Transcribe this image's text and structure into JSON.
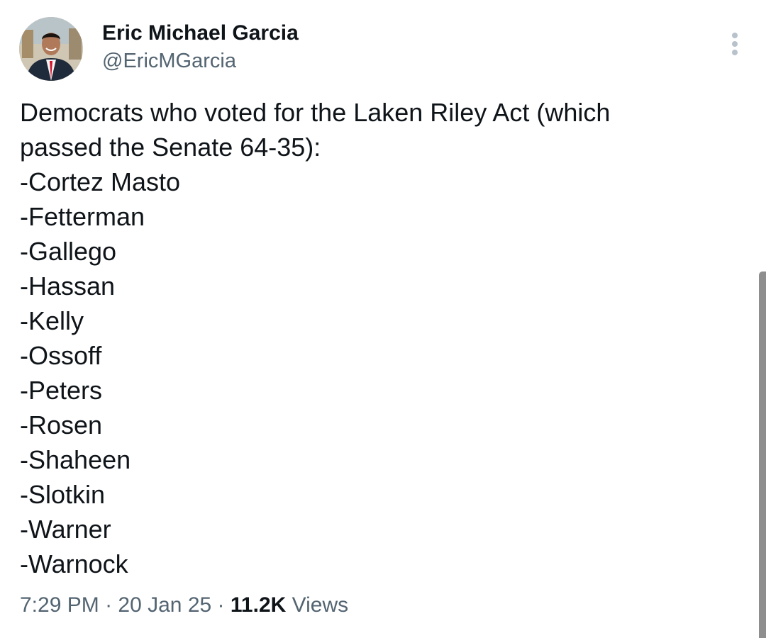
{
  "author": {
    "display_name": "Eric Michael Garcia",
    "handle": "@EricMGarcia",
    "avatar_icon": "profile-photo"
  },
  "tweet": {
    "intro_lines": [
      "Democrats who voted for the Laken Riley Act (which",
      "passed the Senate 64-35):"
    ],
    "names": [
      "-Cortez Masto",
      "-Fetterman",
      "-Gallego",
      "-Hassan",
      "-Kelly",
      "-Ossoff",
      "-Peters",
      "-Rosen",
      "-Shaheen",
      "-Slotkin",
      "-Warner",
      "-Warnock"
    ]
  },
  "meta": {
    "time": "7:29 PM",
    "separator": "·",
    "date": "20 Jan 25",
    "views_count": "11.2K",
    "views_label": "Views"
  },
  "icons": {
    "more": "more-vertical-icon"
  },
  "colors": {
    "primary_text": "#0f1419",
    "secondary_text": "#536471",
    "scrollbar": "#8e8e8e"
  }
}
